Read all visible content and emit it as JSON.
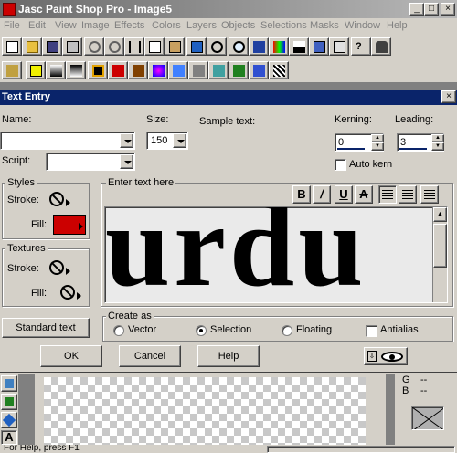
{
  "app": {
    "title": "Jasc Paint Shop Pro - Image5",
    "min_glyph": "_",
    "max_glyph": "□",
    "close_glyph": "×"
  },
  "menu": [
    "File",
    "Edit",
    "View",
    "Image",
    "Effects",
    "Colors",
    "Layers",
    "Objects",
    "Selections",
    "Masks",
    "Window",
    "Help"
  ],
  "dialog": {
    "title": "Text Entry",
    "close_glyph": "×",
    "name_label": "Name:",
    "name_value": "",
    "script_label": "Script:",
    "script_value": "",
    "size_label": "Size:",
    "size_value": "150",
    "sample_label": "Sample text:",
    "kerning_label": "Kerning:",
    "kerning_value": "0",
    "leading_label": "Leading:",
    "leading_value": "3",
    "auto_kern_label": "Auto kern",
    "styles_label": "Styles",
    "stroke_label": "Stroke:",
    "fill_label": "Fill:",
    "fill_color": "#cc0000",
    "textures_label": "Textures",
    "tex_stroke_label": "Stroke:",
    "tex_fill_label": "Fill:",
    "enter_text_label": "Enter text here",
    "entered_text": "urdu",
    "format_buttons": {
      "bold": "B",
      "italic": "/",
      "underline": "U",
      "strike": "A"
    },
    "create_as_label": "Create as",
    "vector_label": "Vector",
    "selection_label": "Selection",
    "floating_label": "Floating",
    "antialias_label": "Antialias",
    "standard_text_label": "Standard text",
    "ok_label": "OK",
    "cancel_label": "Cancel",
    "help_label": "Help"
  },
  "right_panel": {
    "g_label": "G",
    "g_value": "--",
    "b_label": "B",
    "b_value": "--"
  },
  "statusbar": {
    "left_text": "For Help, press F1",
    "right_text": ""
  },
  "colors": {
    "title_active": "#0a246a",
    "face": "#d4d0c8",
    "fill_swatch": "#cc0000"
  }
}
